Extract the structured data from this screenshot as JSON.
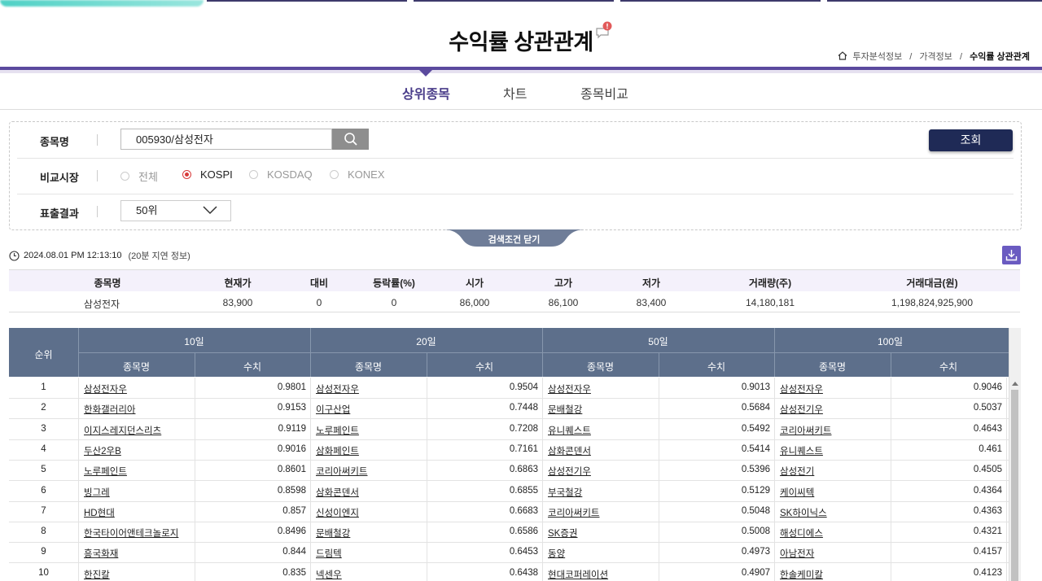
{
  "page": {
    "title": "수익률 상관관계"
  },
  "breadcrumb": {
    "home": "투자분석정보",
    "mid": "가격정보",
    "current": "수익률 상관관계",
    "sep": "/"
  },
  "tabs": [
    "상위종목",
    "차트",
    "종목비교"
  ],
  "search": {
    "stock_label": "종목명",
    "stock_value": "005930/삼성전자",
    "query_label": "조회",
    "market_label": "비교시장",
    "markets": [
      "전체",
      "KOSPI",
      "KOSDAQ",
      "KONEX"
    ],
    "selected_market": "KOSPI",
    "result_label": "표출결과",
    "result_value": "50위",
    "close_label": "검색조건 닫기"
  },
  "timestamp": {
    "time": "2024.08.01 PM 12:13:10",
    "delay": "(20분 지연 정보)"
  },
  "summary": {
    "headers": [
      "종목명",
      "현재가",
      "대비",
      "등락률(%)",
      "시가",
      "고가",
      "저가",
      "거래량(주)",
      "거래대금(원)"
    ],
    "values": [
      "삼성전자",
      "83,900",
      "0",
      "0",
      "86,000",
      "86,100",
      "83,400",
      "14,180,181",
      "1,198,824,925,900"
    ]
  },
  "table": {
    "rank_header": "순위",
    "periods": [
      "10일",
      "20일",
      "50일",
      "100일"
    ],
    "name_header": "종목명",
    "value_header": "수치",
    "rows": [
      {
        "rank": "1",
        "cells": [
          [
            "삼성전자우",
            "0.9801"
          ],
          [
            "삼성전자우",
            "0.9504"
          ],
          [
            "삼성전자우",
            "0.9013"
          ],
          [
            "삼성전자우",
            "0.9046"
          ]
        ]
      },
      {
        "rank": "2",
        "cells": [
          [
            "한화갤러리아",
            "0.9153"
          ],
          [
            "이구산업",
            "0.7448"
          ],
          [
            "문배철강",
            "0.5684"
          ],
          [
            "삼성전기우",
            "0.5037"
          ]
        ]
      },
      {
        "rank": "3",
        "cells": [
          [
            "이지스레지던스리츠",
            "0.9119"
          ],
          [
            "노루페인트",
            "0.7208"
          ],
          [
            "유니퀘스트",
            "0.5492"
          ],
          [
            "코리아써키트",
            "0.4643"
          ]
        ]
      },
      {
        "rank": "4",
        "cells": [
          [
            "두산2우B",
            "0.9016"
          ],
          [
            "삼화페인트",
            "0.7161"
          ],
          [
            "삼화콘덴서",
            "0.5414"
          ],
          [
            "유니퀘스트",
            "0.461"
          ]
        ]
      },
      {
        "rank": "5",
        "cells": [
          [
            "노루페인트",
            "0.8601"
          ],
          [
            "코리아써키트",
            "0.6863"
          ],
          [
            "삼성전기우",
            "0.5396"
          ],
          [
            "삼성전기",
            "0.4505"
          ]
        ]
      },
      {
        "rank": "6",
        "cells": [
          [
            "빙그레",
            "0.8598"
          ],
          [
            "삼화콘덴서",
            "0.6855"
          ],
          [
            "부국철강",
            "0.5129"
          ],
          [
            "케이씨텍",
            "0.4364"
          ]
        ]
      },
      {
        "rank": "7",
        "cells": [
          [
            "HD현대",
            "0.857"
          ],
          [
            "신성이엔지",
            "0.6683"
          ],
          [
            "코리아써키트",
            "0.5048"
          ],
          [
            "SK하이닉스",
            "0.4363"
          ]
        ]
      },
      {
        "rank": "8",
        "cells": [
          [
            "한국타이어앤테크놀로지",
            "0.8496"
          ],
          [
            "문배철강",
            "0.6586"
          ],
          [
            "SK증권",
            "0.5008"
          ],
          [
            "해성디에스",
            "0.4321"
          ]
        ]
      },
      {
        "rank": "9",
        "cells": [
          [
            "흥국화재",
            "0.844"
          ],
          [
            "드림텍",
            "0.6453"
          ],
          [
            "동양",
            "0.4973"
          ],
          [
            "아남전자",
            "0.4157"
          ]
        ]
      },
      {
        "rank": "10",
        "cells": [
          [
            "한진칼",
            "0.835"
          ],
          [
            "넥센우",
            "0.6438"
          ],
          [
            "현대코퍼레이션",
            "0.4907"
          ],
          [
            "한솔케미칼",
            "0.4123"
          ]
        ]
      }
    ]
  },
  "colors": {
    "accent": "#5b4a9e",
    "query_button": "#1f2a56",
    "table_header": "#5d6f8b",
    "radio_on": "#d83a3a"
  }
}
